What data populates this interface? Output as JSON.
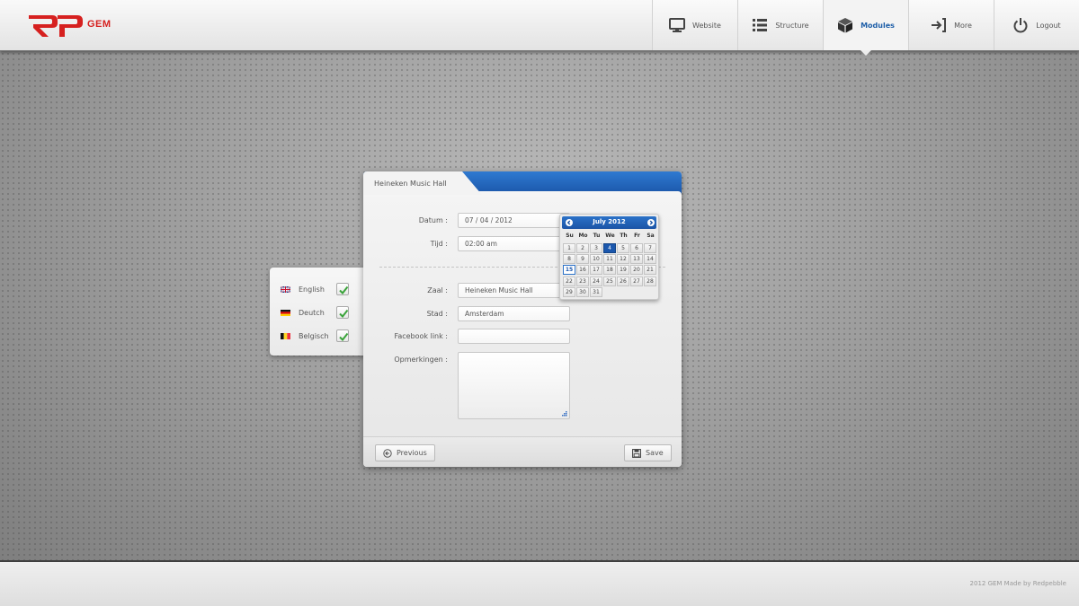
{
  "app": {
    "logo_text": "GEM",
    "footer_text": "2012 GEM Made by Redpebble"
  },
  "nav": [
    {
      "label": "Website",
      "icon": "monitor-icon",
      "active": false
    },
    {
      "label": "Structure",
      "icon": "list-icon",
      "active": false
    },
    {
      "label": "Modules",
      "icon": "cube-icon",
      "active": true
    },
    {
      "label": "More",
      "icon": "enter-icon",
      "active": false
    },
    {
      "label": "Logout",
      "icon": "power-icon",
      "active": false
    }
  ],
  "languages": [
    {
      "label": "English",
      "flag": "uk-flag-icon",
      "checked": true
    },
    {
      "label": "Deutch",
      "flag": "germany-flag-icon",
      "checked": true
    },
    {
      "label": "Belgisch",
      "flag": "belgium-flag-icon",
      "checked": true
    }
  ],
  "form": {
    "tab_title": "Heineken Music Hall",
    "date_label": "Datum :",
    "date_value": "07 / 04 / 2012",
    "time_label": "Tijd :",
    "time_value": "02:00 am",
    "venue_label": "Zaal :",
    "venue_value": "Heineken Music Hall",
    "city_label": "Stad :",
    "city_value": "Amsterdam",
    "facebook_label": "Facebook link :",
    "facebook_value": "",
    "remarks_label": "Opmerkingen :",
    "remarks_value": "",
    "previous_label": "Previous",
    "save_label": "Save"
  },
  "datepicker": {
    "title": "July 2012",
    "weekdays": [
      "Su",
      "Mo",
      "Tu",
      "We",
      "Th",
      "Fr",
      "Sa"
    ],
    "start_weekday": 0,
    "days_in_month": 31,
    "selected_day": 4,
    "today_day": 15
  },
  "colors": {
    "accent_blue": "#1b57ad",
    "brand_red": "#d6201f",
    "check_green": "#3aa33a"
  }
}
